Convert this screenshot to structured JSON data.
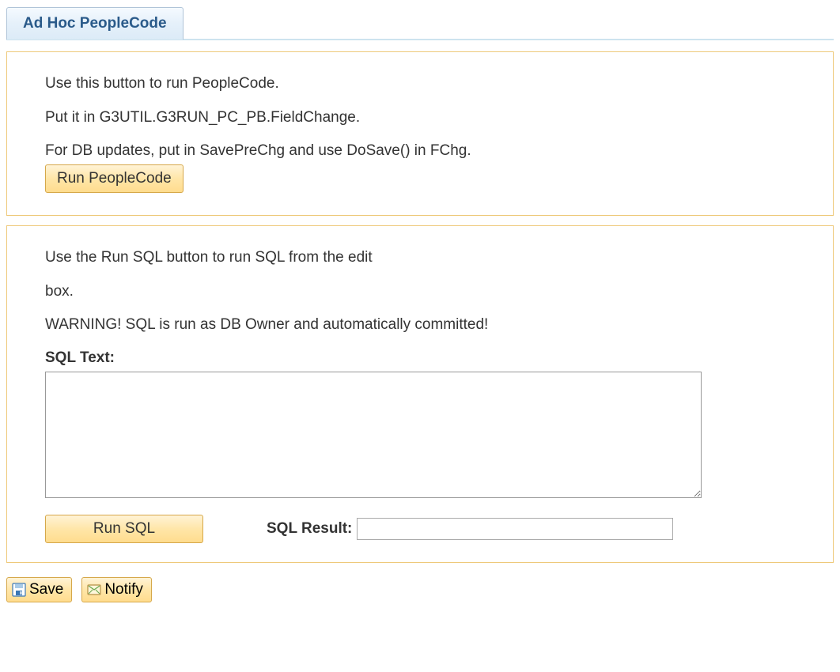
{
  "tab": {
    "label": "Ad Hoc PeopleCode"
  },
  "peoplecode_section": {
    "line1": "Use this button to run PeopleCode.",
    "line2": "Put it in G3UTIL.G3RUN_PC_PB.FieldChange.",
    "line3": "For DB updates, put in SavePreChg and use DoSave() in FChg.",
    "run_button": "Run PeopleCode"
  },
  "sql_section": {
    "line1": "Use the Run SQL button to run SQL from the edit",
    "line2": "box.",
    "line3": "WARNING! SQL is run as DB Owner and automatically committed!",
    "sql_text_label": "SQL Text:",
    "sql_text_value": "",
    "run_button": "Run SQL",
    "result_label": "SQL Result:",
    "result_value": ""
  },
  "footer": {
    "save_label": "Save",
    "notify_label": "Notify"
  }
}
